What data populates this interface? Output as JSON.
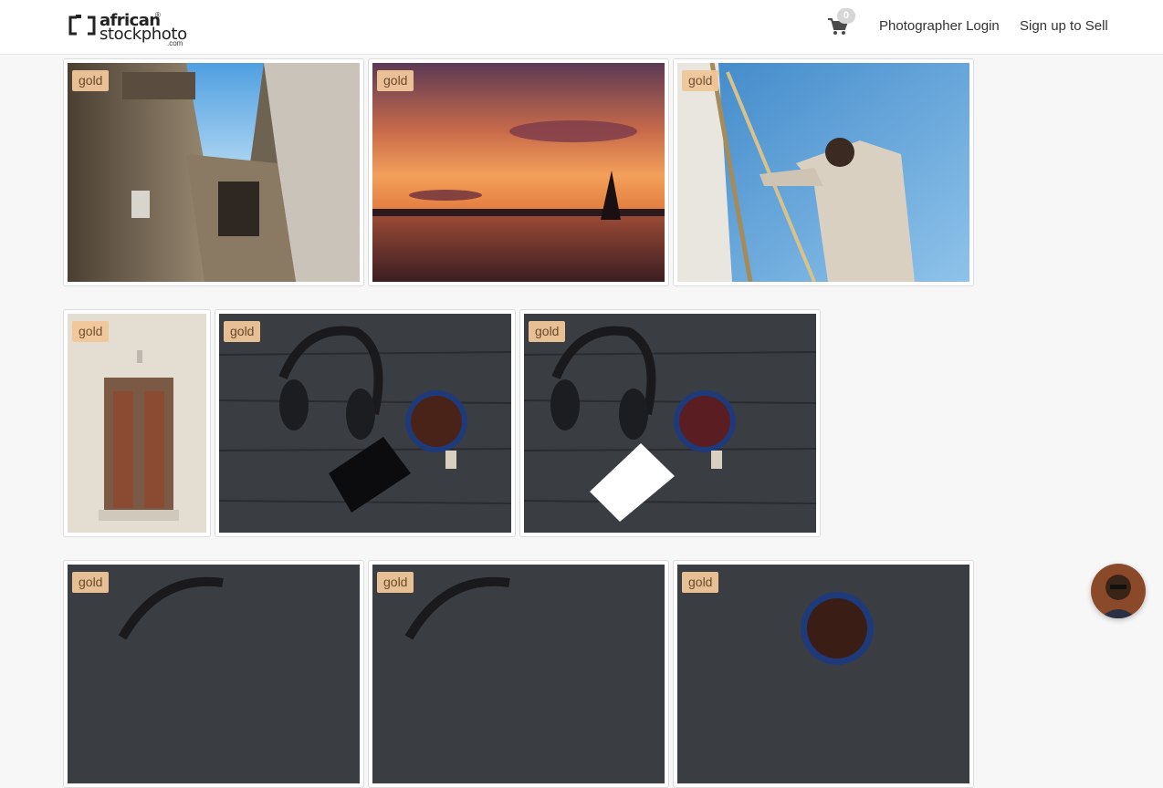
{
  "header": {
    "logo_line1": "african",
    "logo_line2": "stockphoto",
    "logo_reg": "®",
    "logo_com": ".com",
    "cart_count": "0",
    "login_label": "Photographer Login",
    "signup_label": "Sign up to Sell"
  },
  "gallery": {
    "badge_label": "gold",
    "rows": [
      [
        "courtyard-building",
        "sunset-dhow",
        "man-on-sailboat"
      ],
      [
        "carved-door",
        "headphones-phone-tea",
        "headphones-white-phone-tea"
      ],
      [
        "headphones-partial-1",
        "headphones-partial-2",
        "tea-cup-partial"
      ]
    ]
  },
  "colors": {
    "badge_bg": "#f1c79a",
    "badge_text": "#6b4a2a",
    "page_bg": "#f7f7f7"
  }
}
